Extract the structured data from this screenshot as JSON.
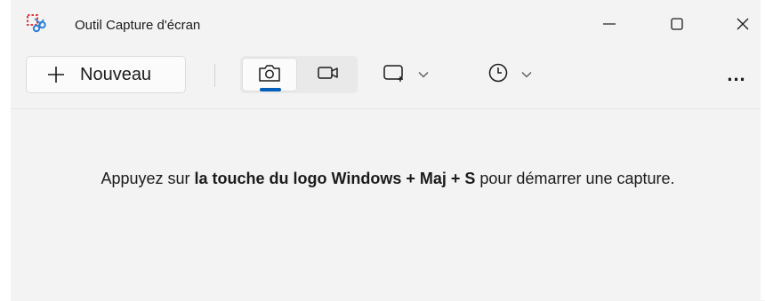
{
  "window": {
    "title": "Outil Capture d'écran",
    "controls": {
      "minimize": "minimize-icon",
      "maximize": "maximize-icon",
      "close": "close-icon"
    }
  },
  "toolbar": {
    "new_label": "Nouveau",
    "modes": [
      {
        "name": "photo",
        "icon": "camera-icon",
        "selected": true
      },
      {
        "name": "video",
        "icon": "video-camera-icon",
        "selected": false
      }
    ],
    "shape_icon": "rectangle-snip-icon",
    "delay_icon": "clock-icon",
    "more_label": "..."
  },
  "message": {
    "prefix": "Appuyez sur ",
    "bold": "la touche du logo Windows + Maj + S",
    "suffix": " pour démarrer une capture."
  },
  "colors": {
    "accent": "#005fb8",
    "background": "#f3f3f3",
    "button": "#fbfbfb",
    "text": "#1b1b1b"
  }
}
